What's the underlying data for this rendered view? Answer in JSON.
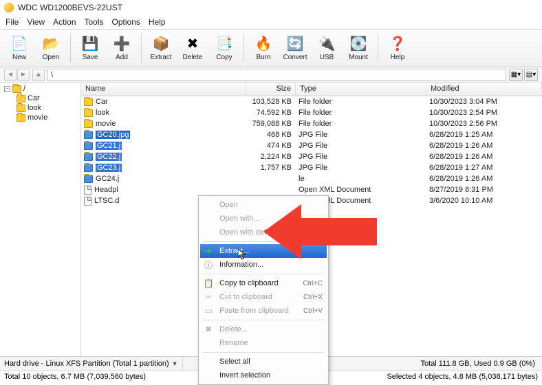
{
  "title": "WDC WD1200BEVS-22UST",
  "menu": [
    "File",
    "View",
    "Action",
    "Tools",
    "Options",
    "Help"
  ],
  "toolbar": [
    {
      "label": "New",
      "icon": "📄"
    },
    {
      "label": "Open",
      "icon": "📂"
    },
    {
      "sep": true
    },
    {
      "label": "Save",
      "icon": "💾"
    },
    {
      "label": "Add",
      "icon": "➕"
    },
    {
      "sep": true
    },
    {
      "label": "Extract",
      "icon": "📦"
    },
    {
      "label": "Delete",
      "icon": "✖"
    },
    {
      "label": "Copy",
      "icon": "📑"
    },
    {
      "sep": true
    },
    {
      "label": "Burn",
      "icon": "🔥"
    },
    {
      "label": "Convert",
      "icon": "🔄"
    },
    {
      "label": "USB",
      "icon": "🔌"
    },
    {
      "label": "Mount",
      "icon": "💽"
    },
    {
      "sep": true
    },
    {
      "label": "Help",
      "icon": "❓"
    }
  ],
  "path": "\\",
  "tree": {
    "root": "/",
    "children": [
      "Car",
      "look",
      "movie"
    ]
  },
  "columns": {
    "name": "Name",
    "size": "Size",
    "type": "Type",
    "mod": "Modified"
  },
  "files": [
    {
      "name": "Car",
      "size": "103,528 KB",
      "type": "File folder",
      "mod": "10/30/2023 3:04 PM",
      "icon": "folder"
    },
    {
      "name": "look",
      "size": "74,592 KB",
      "type": "File folder",
      "mod": "10/30/2023 2:54 PM",
      "icon": "folder"
    },
    {
      "name": "movie",
      "size": "759,088 KB",
      "type": "File folder",
      "mod": "10/30/2023 2:56 PM",
      "icon": "folder"
    },
    {
      "name": "GC20.jpg",
      "size": "468 KB",
      "type": "JPG File",
      "mod": "6/28/2019 1:25 AM",
      "icon": "img",
      "sel": true
    },
    {
      "name": "GC21.j",
      "size": "474 KB",
      "type": "JPG File",
      "mod": "6/28/2019 1:26 AM",
      "icon": "img",
      "sel": true,
      "cut": true
    },
    {
      "name": "GC22.j",
      "size": "2,224 KB",
      "type": "JPG File",
      "mod": "6/28/2019 1:26 AM",
      "icon": "img",
      "sel": true,
      "cut": true
    },
    {
      "name": "GC23.j",
      "size": "1,757 KB",
      "type": "JPG File",
      "mod": "6/28/2019 1:27 AM",
      "icon": "img",
      "sel": true,
      "cut": true
    },
    {
      "name": "GC24.j",
      "size": "",
      "type": "le",
      "mod": "6/28/2019 1:26 AM",
      "icon": "img"
    },
    {
      "name": "Headpl",
      "size": "",
      "type": "Open XML Document",
      "mod": "8/27/2019 8:31 PM",
      "icon": "doc"
    },
    {
      "name": "LTSC.d",
      "size": "",
      "type": "Open XML Document",
      "mod": "3/6/2020 10:10 AM",
      "icon": "doc"
    }
  ],
  "ctx": {
    "open": "Open",
    "openwith": "Open with...",
    "opendef": "Open with default viewer",
    "extract": "Extract...",
    "info": "Information...",
    "copy": "Copy to clipboard",
    "copy_key": "Ctrl+C",
    "cut": "Cut to clipboard",
    "cut_key": "Ctrl+X",
    "paste": "Paste from clipboard",
    "paste_key": "Ctrl+V",
    "delete": "Delete...",
    "rename": "Rename",
    "selectall": "Select all",
    "invert": "Invert selection"
  },
  "status": {
    "left": "Hard drive - Linux XFS Partition (Total 1 partition)",
    "right": "Total 111.8 GB, Used 0.9 GB (0%)",
    "bottom_left": "Total 10 objects, 6.7 MB (7,039,560 bytes)",
    "bottom_right": "Selected 4 objects, 4.8 MB (5,038,171 bytes)"
  }
}
